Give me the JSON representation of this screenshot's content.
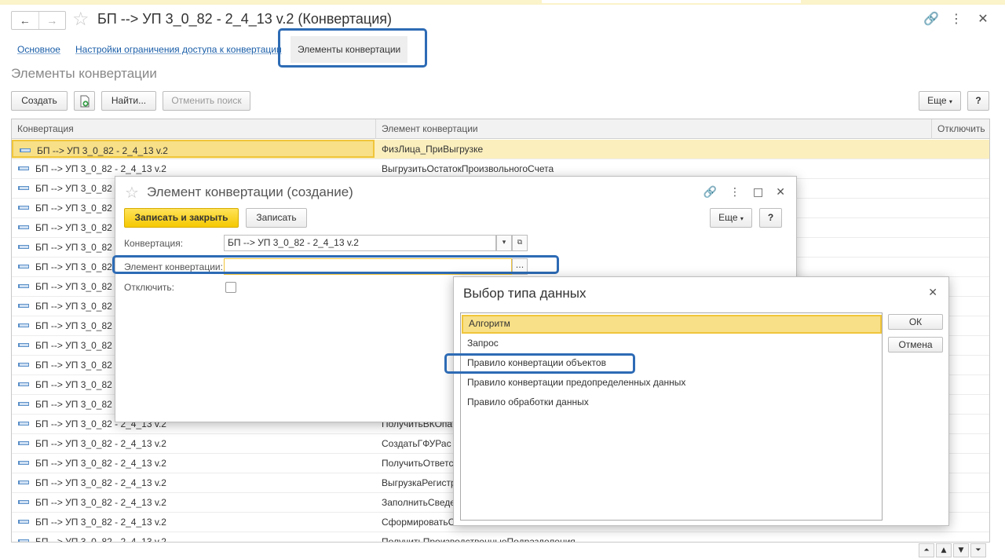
{
  "window": {
    "title": "БП --> УП 3_0_82 - 2_4_13 v.2 (Конвертация)",
    "back": "←",
    "forward": "→",
    "star": "☆",
    "link": "🔗",
    "more": "⋮",
    "close": "✕"
  },
  "tabs": [
    {
      "label": "Основное"
    },
    {
      "label": "Настройки ограничения доступа к конвертации"
    },
    {
      "label": "Элементы конвертации",
      "active": true
    }
  ],
  "section_title": "Элементы конвертации",
  "toolbar": {
    "create": "Создать",
    "find": "Найти...",
    "cancel_search": "Отменить поиск",
    "more": "Еще",
    "help": "?"
  },
  "table": {
    "columns": [
      "Конвертация",
      "Элемент конвертации",
      "Отключить"
    ],
    "rows": [
      {
        "c1": "БП --> УП 3_0_82 - 2_4_13 v.2",
        "c2": "ФизЛица_ПриВыгрузке",
        "selected": true
      },
      {
        "c1": "БП --> УП 3_0_82 - 2_4_13 v.2",
        "c2": "ВыгрузитьОстатокПроизвольногоСчета"
      },
      {
        "c1": "БП --> УП 3_0_82",
        "c2": ""
      },
      {
        "c1": "БП --> УП 3_0_82",
        "c2": ""
      },
      {
        "c1": "БП --> УП 3_0_82",
        "c2": ""
      },
      {
        "c1": "БП --> УП 3_0_82",
        "c2": ""
      },
      {
        "c1": "БП --> УП 3_0_82",
        "c2": ""
      },
      {
        "c1": "БП --> УП 3_0_82",
        "c2": ""
      },
      {
        "c1": "БП --> УП 3_0_82",
        "c2": ""
      },
      {
        "c1": "БП --> УП 3_0_82",
        "c2": ""
      },
      {
        "c1": "БП --> УП 3_0_82",
        "c2": ""
      },
      {
        "c1": "БП --> УП 3_0_82",
        "c2": ""
      },
      {
        "c1": "БП --> УП 3_0_82",
        "c2": ""
      },
      {
        "c1": "БП --> УП 3_0_82",
        "c2": ""
      },
      {
        "c1": "БП --> УП 3_0_82 - 2_4_13 v.2",
        "c2": "ПолучитьВКОпа"
      },
      {
        "c1": "БП --> УП 3_0_82 - 2_4_13 v.2",
        "c2": "СоздатьГФУРас"
      },
      {
        "c1": "БП --> УП 3_0_82 - 2_4_13 v.2",
        "c2": "ПолучитьОтветс"
      },
      {
        "c1": "БП --> УП 3_0_82 - 2_4_13 v.2",
        "c2": "ВыгрузкаРегистр"
      },
      {
        "c1": "БП --> УП 3_0_82 - 2_4_13 v.2",
        "c2": "ЗаполнитьСведе"
      },
      {
        "c1": "БП --> УП 3_0_82 - 2_4_13 v.2",
        "c2": "СформироватьС"
      },
      {
        "c1": "БП --> УП 3_0_82 - 2_4_13 v.2",
        "c2": "ПолучитьПроизводственныеПодразделения"
      }
    ]
  },
  "scroll_buttons": [
    "⏶",
    "▲",
    "▼",
    "⏷"
  ],
  "create_dialog": {
    "title": "Элемент конвертации (создание)",
    "save_close": "Записать и закрыть",
    "save": "Записать",
    "more": "Еще",
    "help": "?",
    "conversion_label": "Конвертация:",
    "conversion_value": "БП --> УП 3_0_82 - 2_4_13 v.2",
    "element_label": "Элемент конвертации:",
    "element_value": "",
    "disable_label": "Отключить:",
    "select_btn": "...",
    "dropdown_btn": "▾",
    "open_btn": "⧉",
    "maximize": "□",
    "close": "✕",
    "link": "🔗",
    "menu": "⋮",
    "star": "☆"
  },
  "type_dialog": {
    "title": "Выбор типа данных",
    "close": "✕",
    "ok": "ОК",
    "cancel": "Отмена",
    "items": [
      {
        "label": "Алгоритм",
        "selected": true
      },
      {
        "label": "Запрос"
      },
      {
        "label": "Правило конвертации объектов"
      },
      {
        "label": "Правило конвертации предопределенных данных"
      },
      {
        "label": "Правило обработки данных"
      }
    ]
  },
  "colors": {
    "accent_yellow": "#f5c800",
    "selection": "#f8e088",
    "callout_blue": "#2d6bb5",
    "link": "#1a5ea8"
  }
}
